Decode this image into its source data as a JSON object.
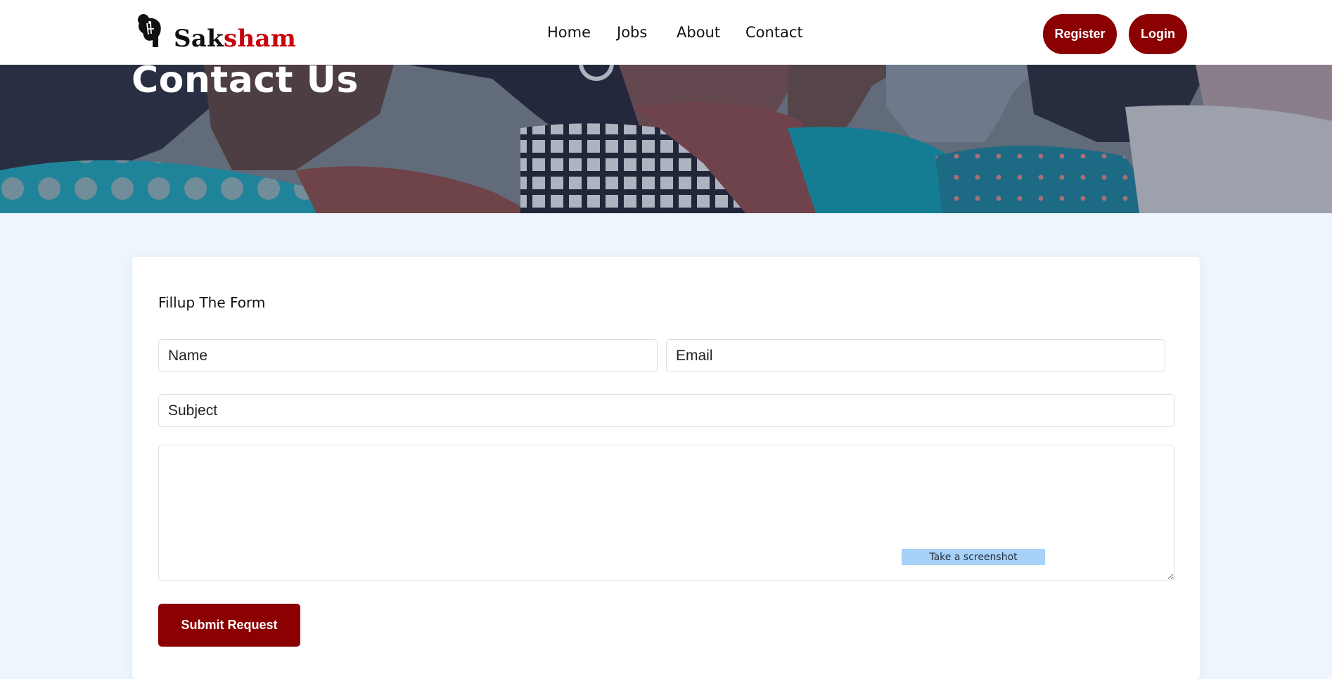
{
  "brand": {
    "name_part_1": "Sak",
    "name_part_2": "sham",
    "accent": "#c8000a"
  },
  "nav": {
    "items": [
      "Home",
      "Jobs",
      "About",
      "Contact"
    ]
  },
  "auth": {
    "register_label": "Register",
    "login_label": "Login",
    "color": "#8b0000"
  },
  "hero": {
    "title": "Contact Us"
  },
  "form": {
    "heading": "Fillup The Form",
    "name_placeholder": "Name",
    "email_placeholder": "Email",
    "subject_placeholder": "Subject",
    "message_placeholder": "",
    "submit_label": "Submit Request"
  },
  "tooltip": {
    "text": "Take a screenshot"
  },
  "colors": {
    "page_bg": "#eef5fd",
    "button": "#8b0000",
    "tooltip_bg": "#a8d1f7"
  }
}
